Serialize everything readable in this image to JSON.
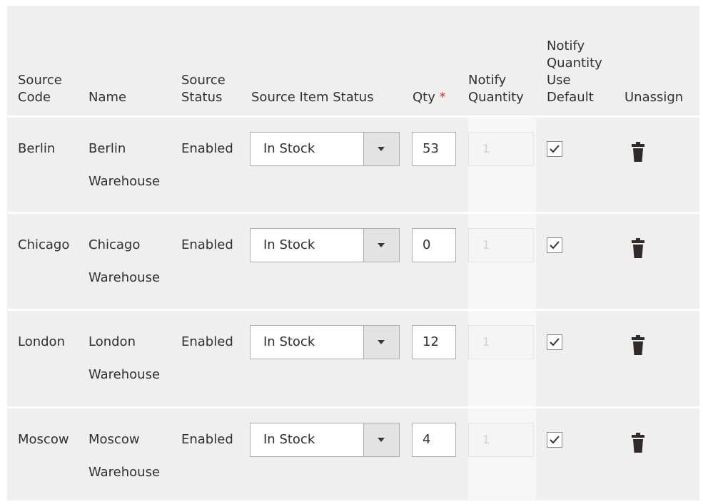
{
  "header": {
    "source_code": [
      "Source",
      "Code"
    ],
    "name": "Name",
    "source_status": [
      "Source",
      "Status"
    ],
    "source_item_status": "Source Item Status",
    "qty": "Qty",
    "qty_required_mark": "*",
    "notify_quantity": [
      "Notify",
      "Quantity"
    ],
    "notify_quantity_use_default": [
      "Notify",
      "Quantity",
      "Use",
      "Default"
    ],
    "unassign": "Unassign"
  },
  "rows": [
    {
      "code": "Berlin",
      "name_line1": "Berlin",
      "name_line2": "Warehouse",
      "status": "Enabled",
      "item_status": "In Stock",
      "qty": "53",
      "notify_qty": "1",
      "use_default": true
    },
    {
      "code": "Chicago",
      "name_line1": "Chicago",
      "name_line2": "Warehouse",
      "status": "Enabled",
      "item_status": "In Stock",
      "qty": "0",
      "notify_qty": "1",
      "use_default": true
    },
    {
      "code": "London",
      "name_line1": "London",
      "name_line2": "Warehouse",
      "status": "Enabled",
      "item_status": "In Stock",
      "qty": "12",
      "notify_qty": "1",
      "use_default": true
    },
    {
      "code": "Moscow",
      "name_line1": "Moscow",
      "name_line2": "Warehouse",
      "status": "Enabled",
      "item_status": "In Stock",
      "qty": "4",
      "notify_qty": "1",
      "use_default": true
    }
  ],
  "icons": {
    "select_arrow": "chevron-down-icon",
    "checkbox": "checkmark-icon",
    "unassign": "trash-icon"
  },
  "colors": {
    "panel_bg": "#efefef",
    "required": "#e02b27",
    "text": "#303030"
  }
}
